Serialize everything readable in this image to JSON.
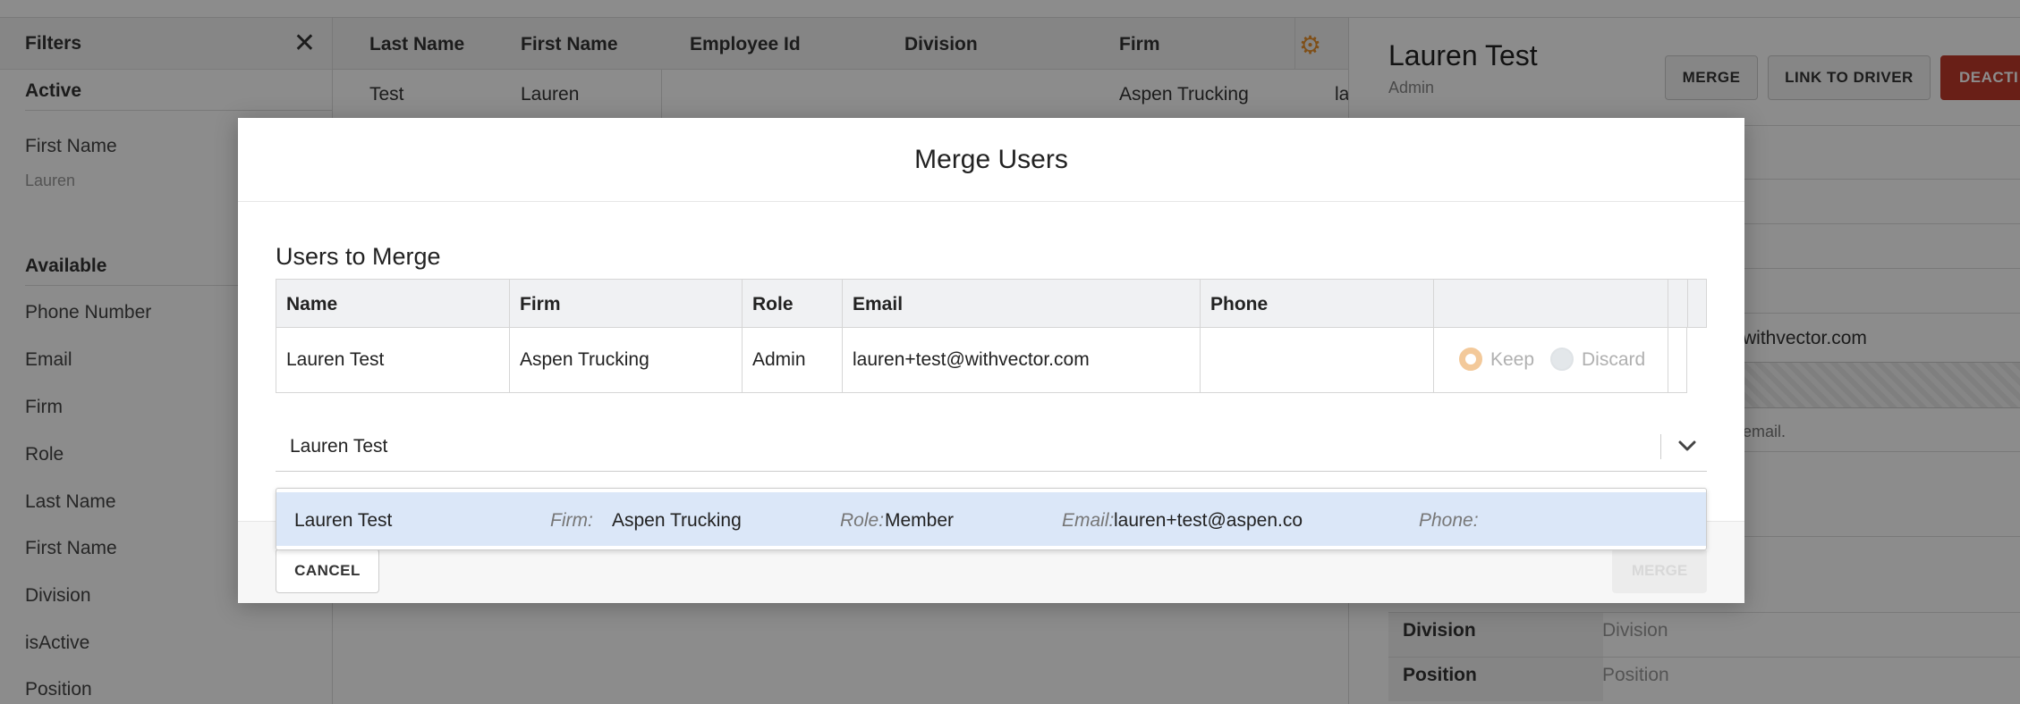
{
  "filters": {
    "title": "Filters",
    "active_heading": "Active",
    "active_items": [
      {
        "label": "First Name",
        "value": "Lauren"
      }
    ],
    "available_heading": "Available",
    "available_items": [
      "Phone Number",
      "Email",
      "Firm",
      "Role",
      "Last Name",
      "First Name",
      "Division",
      "isActive",
      "Position"
    ]
  },
  "table": {
    "headers": [
      "Last Name",
      "First Name",
      "Employee Id",
      "Division",
      "Firm"
    ],
    "row": {
      "last_name": "Test",
      "first_name": "Lauren",
      "firm": "Aspen Trucking",
      "partial": "la"
    }
  },
  "detail": {
    "name": "Lauren Test",
    "role": "Admin",
    "buttons": {
      "merge": "MERGE",
      "link_to_driver": "LINK TO DRIVER",
      "deactivate": "DEACTI"
    },
    "email_partial": "withvector.com",
    "hint_partial": "email.",
    "fields": [
      {
        "label": "Division",
        "placeholder": "Division"
      },
      {
        "label": "Position",
        "placeholder": "Position"
      }
    ]
  },
  "modal": {
    "title": "Merge Users",
    "section_title": "Users to Merge",
    "columns": [
      "Name",
      "Firm",
      "Role",
      "Email",
      "Phone"
    ],
    "users": [
      {
        "name": "Lauren Test",
        "firm": "Aspen Trucking",
        "role": "Admin",
        "email": "lauren+test@withvector.com",
        "phone": "",
        "keep_label": "Keep",
        "discard_label": "Discard",
        "selected": "Keep"
      }
    ],
    "select": {
      "value": "Lauren Test"
    },
    "options": [
      {
        "name": "Lauren Test",
        "firm_key": "Firm:",
        "firm": "Aspen Trucking",
        "role_key": "Role:",
        "role": "Member",
        "email_key": "Email:",
        "email": "lauren+test@aspen.co",
        "phone_key": "Phone:",
        "phone": ""
      }
    ],
    "cancel_label": "CANCEL",
    "merge_label": "MERGE"
  },
  "colors": {
    "accent": "#e8912d",
    "danger": "#c0392b",
    "option_highlight": "#dbe7f8",
    "radio_selected": "#f3c99a"
  }
}
